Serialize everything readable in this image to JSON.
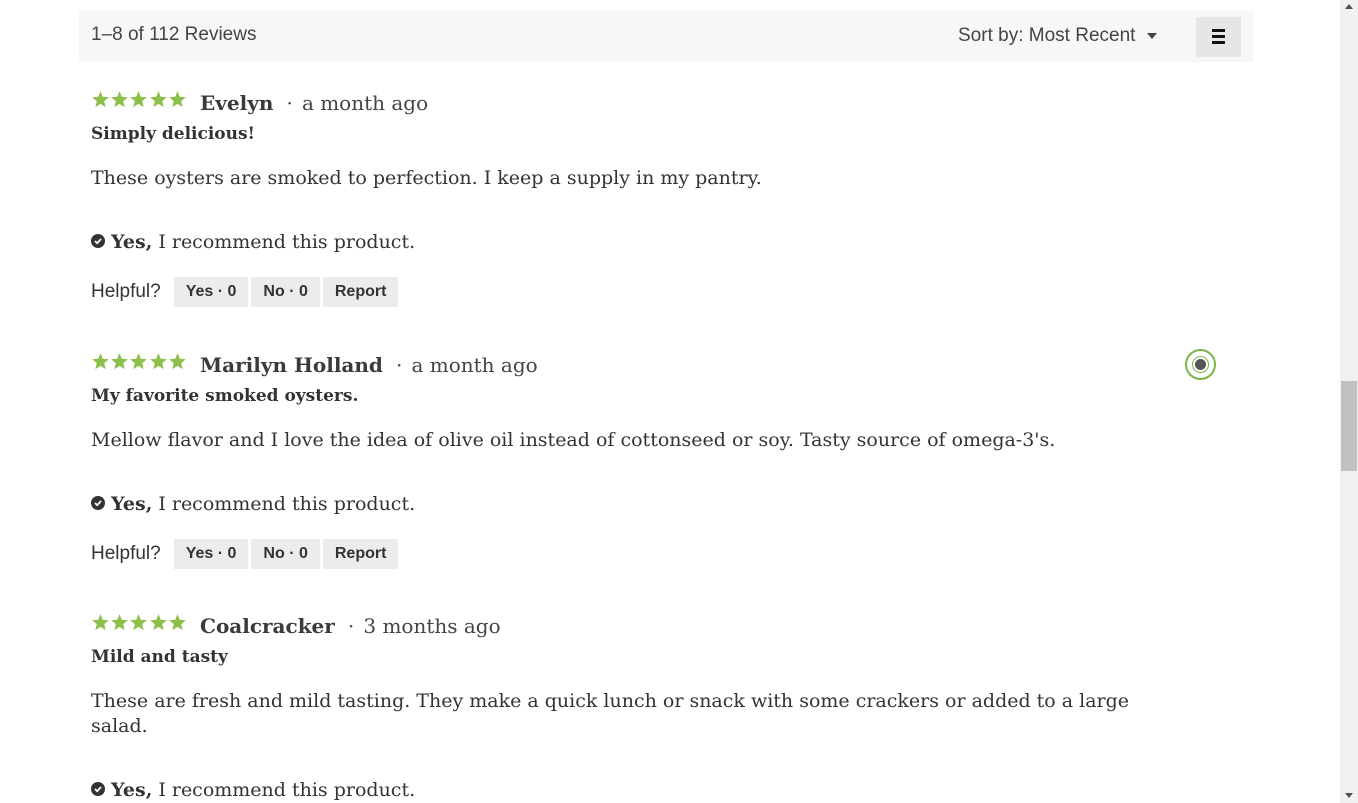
{
  "toolbar": {
    "count_text": "1–8 of 112 Reviews",
    "sort_label": "Sort by:",
    "sort_value": "Most Recent",
    "menu_icon": "hamburger-icon"
  },
  "colors": {
    "star": "#8cc04b",
    "badge": "#7ab648"
  },
  "reviews": [
    {
      "rating": 5,
      "author": "Evelyn",
      "separator": "·",
      "time": "a month ago",
      "title": "Simply delicious!",
      "body": "These oysters are smoked to perfection. I keep a supply in my pantry.",
      "recommend_yes": "Yes,",
      "recommend_text": "I recommend this product.",
      "helpful_label": "Helpful?",
      "yes_button": "Yes · 0",
      "no_button": "No · 0",
      "report_button": "Report"
    },
    {
      "rating": 5,
      "author": "Marilyn Holland",
      "separator": "·",
      "time": "a month ago",
      "title": "My favorite smoked oysters.",
      "body": "Mellow flavor and I love the idea of olive oil instead of cottonseed or soy. Tasty source of omega-3's.",
      "recommend_yes": "Yes,",
      "recommend_text": "I recommend this product.",
      "helpful_label": "Helpful?",
      "yes_button": "Yes · 0",
      "no_button": "No · 0",
      "report_button": "Report",
      "badge_icon": "reviewer-badge-icon"
    },
    {
      "rating": 5,
      "author": "Coalcracker",
      "separator": "·",
      "time": "3 months ago",
      "title": "Mild and tasty",
      "body": "These are fresh and mild tasting. They make a quick lunch or snack with some crackers or added to a large salad.",
      "recommend_yes": "Yes,",
      "recommend_text": "I recommend this product."
    }
  ]
}
